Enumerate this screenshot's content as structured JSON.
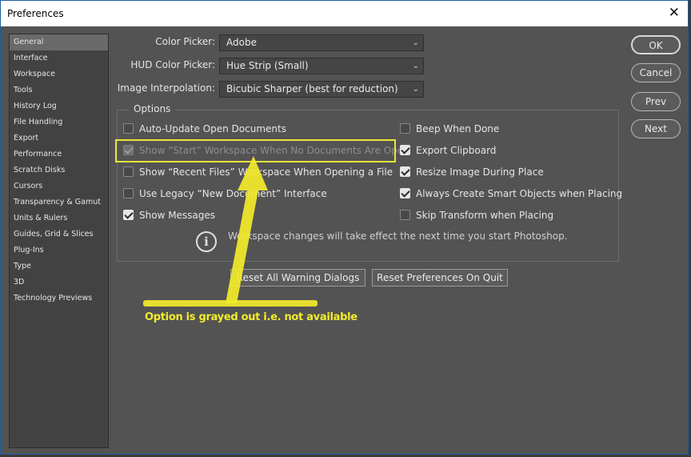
{
  "window": {
    "title": "Preferences",
    "close_glyph": "✕"
  },
  "sidebar": {
    "items": [
      {
        "label": "General",
        "active": true
      },
      {
        "label": "Interface"
      },
      {
        "label": "Workspace"
      },
      {
        "label": "Tools"
      },
      {
        "label": "History Log"
      },
      {
        "label": "File Handling"
      },
      {
        "label": "Export"
      },
      {
        "label": "Performance"
      },
      {
        "label": "Scratch Disks"
      },
      {
        "label": "Cursors"
      },
      {
        "label": "Transparency & Gamut"
      },
      {
        "label": "Units & Rulers"
      },
      {
        "label": "Guides, Grid & Slices"
      },
      {
        "label": "Plug-Ins"
      },
      {
        "label": "Type"
      },
      {
        "label": "3D"
      },
      {
        "label": "Technology Previews"
      }
    ]
  },
  "fields": {
    "color_picker": {
      "label": "Color Picker:",
      "value": "Adobe"
    },
    "hud_color_picker": {
      "label": "HUD Color Picker:",
      "value": "Hue Strip (Small)"
    },
    "image_interpolation": {
      "label": "Image Interpolation:",
      "value": "Bicubic Sharper (best for reduction)"
    }
  },
  "options": {
    "title": "Options",
    "left": [
      {
        "label": "Auto-Update Open Documents",
        "checked": false,
        "disabled": false
      },
      {
        "label": "Show “Start” Workspace When No Documents Are Open",
        "checked": true,
        "disabled": true
      },
      {
        "label": "Show “Recent Files” Workspace When Opening a File",
        "checked": false,
        "disabled": false
      },
      {
        "label": "Use Legacy “New Document” Interface",
        "checked": false,
        "disabled": false
      },
      {
        "label": "Show Messages",
        "checked": true,
        "disabled": false
      }
    ],
    "right": [
      {
        "label": "Beep When Done",
        "checked": false
      },
      {
        "label": "Export Clipboard",
        "checked": true
      },
      {
        "label": "Resize Image During Place",
        "checked": true
      },
      {
        "label": "Always Create Smart Objects when Placing",
        "checked": true
      },
      {
        "label": "Skip Transform when Placing",
        "checked": false
      }
    ],
    "info_icon": "i",
    "info_text": "Workspace changes will take effect the next time you start Photoshop."
  },
  "buttons": {
    "ok": "OK",
    "cancel": "Cancel",
    "prev": "Prev",
    "next": "Next",
    "reset_warnings": "Reset All Warning Dialogs",
    "reset_on_quit": "Reset Preferences On Quit"
  },
  "annotation": {
    "text": "Option is grayed out i.e. not available",
    "color": "#f3ec2a"
  }
}
